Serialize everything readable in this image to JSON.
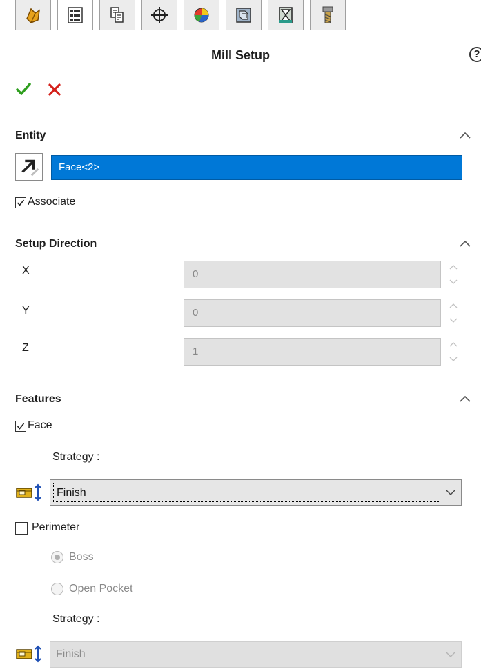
{
  "panel": {
    "title": "Mill Setup",
    "help_glyph": "?"
  },
  "tabs": [
    {
      "icon": "feature-manager-icon"
    },
    {
      "icon": "property-manager-icon"
    },
    {
      "icon": "configuration-manager-icon"
    },
    {
      "icon": "dimxpert-icon"
    },
    {
      "icon": "display-manager-icon"
    },
    {
      "icon": "cam-feature-tree-icon"
    },
    {
      "icon": "cam-operation-tree-icon"
    },
    {
      "icon": "cam-tool-tree-icon"
    }
  ],
  "entity": {
    "section_title": "Entity",
    "selection_value": "Face<2>",
    "associate_label": "Associate",
    "associate_checked": true
  },
  "setup_direction": {
    "section_title": "Setup Direction",
    "axes": [
      {
        "label": "X",
        "value": "0"
      },
      {
        "label": "Y",
        "value": "0"
      },
      {
        "label": "Z",
        "value": "1"
      }
    ]
  },
  "features": {
    "section_title": "Features",
    "face_label": "Face",
    "face_checked": true,
    "face_strategy_label": "Strategy :",
    "face_strategy_value": "Finish",
    "perimeter_label": "Perimeter",
    "perimeter_checked": false,
    "boss_label": "Boss",
    "open_pocket_label": "Open Pocket",
    "perimeter_strategy_label": "Strategy :",
    "perimeter_strategy_value": "Finish"
  },
  "colors": {
    "ok": "#2e9e1e",
    "cancel": "#d4201a",
    "selection": "#0078d7"
  }
}
